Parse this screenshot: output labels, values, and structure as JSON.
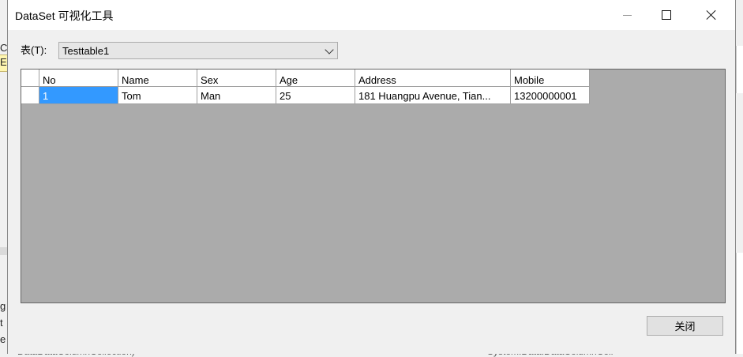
{
  "window": {
    "title": "DataSet 可视化工具"
  },
  "background": {
    "left_chars": [
      "C",
      "Ea",
      "g",
      "t",
      "e"
    ],
    "bottom_text_left": "DataDataColumnCollection)",
    "bottom_text_right": "System.Data.DataColumnColl"
  },
  "toolbar": {
    "table_label": "表(T):",
    "table_selected": "Testtable1"
  },
  "grid": {
    "columns": [
      "No",
      "Name",
      "Sex",
      "Age",
      "Address",
      "Mobile"
    ],
    "rows": [
      [
        "1",
        "Tom",
        "Man",
        "25",
        "181 Huangpu Avenue, Tian...",
        "13200000001"
      ]
    ]
  },
  "footer": {
    "close_label": "关闭"
  },
  "colors": {
    "selection": "#3399ff",
    "grid_background": "#ababab"
  }
}
